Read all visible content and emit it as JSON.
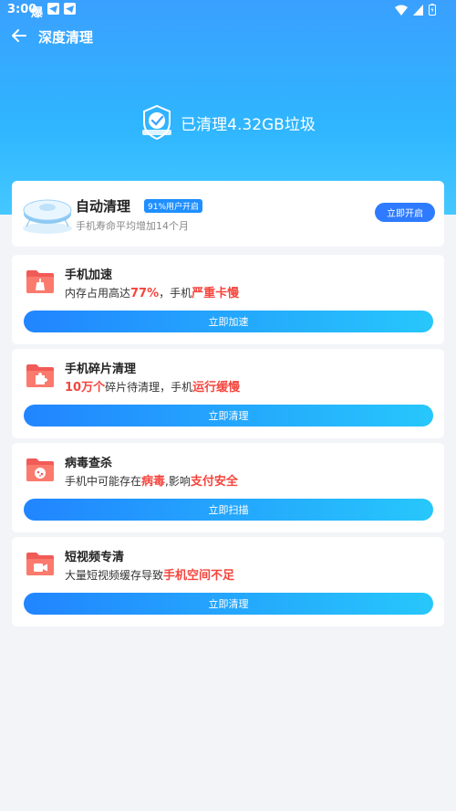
{
  "status": {
    "time": "3:00",
    "notif_glyph": "爆"
  },
  "nav": {
    "title": "深度清理"
  },
  "hero": {
    "cleaned_text": "已清理4.32GB垃圾"
  },
  "auto_clean": {
    "title": "自动清理",
    "badge": "91%用户开启",
    "subtitle": "手机寿命平均增加14个月",
    "button": "立即开启"
  },
  "tasks": [
    {
      "title": "手机加速",
      "desc": [
        "内存占用高达",
        "77%",
        "，手机",
        "严重卡慢"
      ],
      "button": "立即加速",
      "icon": "broom-folder-icon"
    },
    {
      "title": "手机碎片清理",
      "desc": [
        "",
        "10万个",
        "碎片待清理，手机",
        "运行缓慢"
      ],
      "button": "立即清理",
      "icon": "puzzle-folder-icon"
    },
    {
      "title": "病毒查杀",
      "desc": [
        "手机中可能存在",
        "病毒",
        ",影响",
        "支付安全"
      ],
      "button": "立即扫描",
      "icon": "virus-folder-icon"
    },
    {
      "title": "短视频专清",
      "desc": [
        "大量短视频缓存导致",
        "手机空间不足",
        "",
        ""
      ],
      "button": "立即清理",
      "icon": "video-folder-icon"
    }
  ],
  "colors": {
    "accent": "#2e7bff",
    "highlight": "#f5453d",
    "hero_top": "#3aa0ff"
  }
}
